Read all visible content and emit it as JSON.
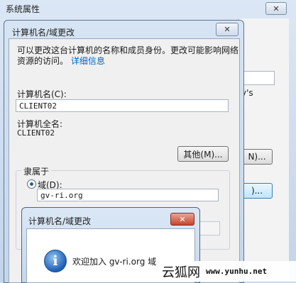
{
  "background_window": {
    "title": "系统属性",
    "close_label": "✕",
    "partial_text": "y's",
    "partial_button_1": "N)...",
    "partial_button_2": ")..."
  },
  "dialog": {
    "title": "计算机名/域更改",
    "close_label": "✕",
    "description": "可以更改这台计算机的名称和成员身份。更改可能影响网络资源的访问。",
    "details_link": "详细信息",
    "computer_name_label": "计算机名(C):",
    "computer_name_value": "CLIENT02",
    "full_name_label": "计算机全名:",
    "full_name_value": "CLIENT02",
    "more_button": "其他(M)...",
    "member_of_label": "隶属于",
    "domain_label": "域(D):",
    "domain_value": "gv-ri.org",
    "domain_selected": true
  },
  "popup": {
    "title": "计算机名/域更改",
    "close_label": "✕",
    "icon": "info-icon",
    "icon_glyph": "i",
    "message": "欢迎加入 gv-ri.org 域"
  },
  "watermark": {
    "site_name": "云狐网",
    "url": "www.yunhu.net"
  }
}
